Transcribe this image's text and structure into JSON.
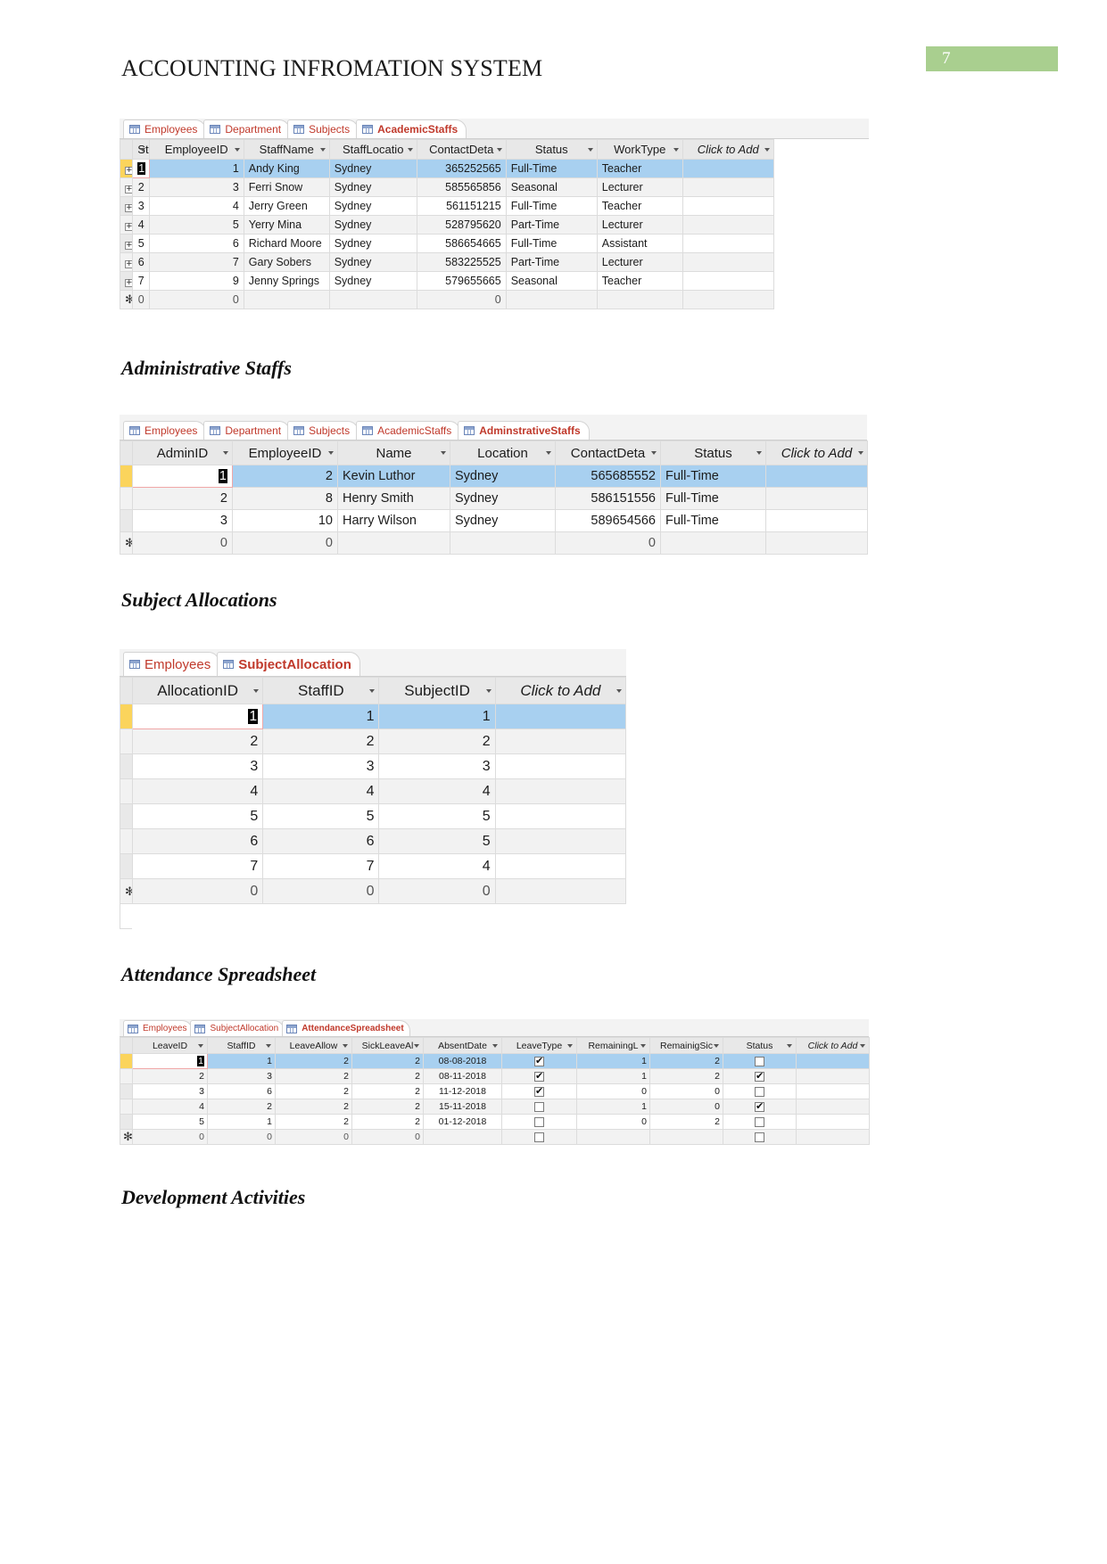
{
  "document": {
    "title": "ACCOUNTING INFROMATION SYSTEM",
    "page_number": "7",
    "accent_green": "#a9cf8f",
    "tab_text_color": "#c0392b",
    "pk_header_color": "#fbd45c",
    "selection_color": "#a8d0f0"
  },
  "headings": {
    "administrative": "Administrative Staffs",
    "subject_allocations": "Subject Allocations",
    "attendance": "Attendance Spreadsheet",
    "development": "Development Activities"
  },
  "academic_staffs": {
    "tabs": [
      {
        "label": "Employees",
        "active": false
      },
      {
        "label": "Department",
        "active": false
      },
      {
        "label": "Subjects",
        "active": false
      },
      {
        "label": "AcademicStaffs",
        "active": true
      }
    ],
    "columns": [
      "StaffID",
      "EmployeeID",
      "StaffName",
      "StaffLocatio",
      "ContactDeta",
      "Status",
      "WorkType",
      "Click to Add"
    ],
    "rows": [
      {
        "StaffID": "1",
        "EmployeeID": "1",
        "StaffName": "Andy King",
        "StaffLocatio": "Sydney",
        "ContactDeta": "365252565",
        "Status": "Full-Time",
        "WorkType": "Teacher"
      },
      {
        "StaffID": "2",
        "EmployeeID": "3",
        "StaffName": "Ferri Snow",
        "StaffLocatio": "Sydney",
        "ContactDeta": "585565856",
        "Status": "Seasonal",
        "WorkType": "Lecturer"
      },
      {
        "StaffID": "3",
        "EmployeeID": "4",
        "StaffName": "Jerry Green",
        "StaffLocatio": "Sydney",
        "ContactDeta": "561151215",
        "Status": "Full-Time",
        "WorkType": "Teacher"
      },
      {
        "StaffID": "4",
        "EmployeeID": "5",
        "StaffName": "Yerry Mina",
        "StaffLocatio": "Sydney",
        "ContactDeta": "528795620",
        "Status": "Part-Time",
        "WorkType": "Lecturer"
      },
      {
        "StaffID": "5",
        "EmployeeID": "6",
        "StaffName": "Richard Moore",
        "StaffLocatio": "Sydney",
        "ContactDeta": "586654665",
        "Status": "Full-Time",
        "WorkType": "Assistant"
      },
      {
        "StaffID": "6",
        "EmployeeID": "7",
        "StaffName": "Gary Sobers",
        "StaffLocatio": "Sydney",
        "ContactDeta": "583225525",
        "Status": "Part-Time",
        "WorkType": "Lecturer"
      },
      {
        "StaffID": "7",
        "EmployeeID": "9",
        "StaffName": "Jenny Springs",
        "StaffLocatio": "Sydney",
        "ContactDeta": "579655665",
        "Status": "Seasonal",
        "WorkType": "Teacher"
      }
    ],
    "new_row": {
      "StaffID": "0",
      "EmployeeID": "0",
      "StaffName": "",
      "StaffLocatio": "",
      "ContactDeta": "0",
      "Status": "",
      "WorkType": ""
    }
  },
  "administrative_staffs": {
    "tabs": [
      {
        "label": "Employees",
        "active": false
      },
      {
        "label": "Department",
        "active": false
      },
      {
        "label": "Subjects",
        "active": false
      },
      {
        "label": "AcademicStaffs",
        "active": false
      },
      {
        "label": "AdminstrativeStaffs",
        "active": true
      }
    ],
    "columns": [
      "AdminID",
      "EmployeeID",
      "Name",
      "Location",
      "ContactDeta",
      "Status",
      "Click to Add"
    ],
    "rows": [
      {
        "AdminID": "1",
        "EmployeeID": "2",
        "Name": "Kevin Luthor",
        "Location": "Sydney",
        "ContactDeta": "565685552",
        "Status": "Full-Time"
      },
      {
        "AdminID": "2",
        "EmployeeID": "8",
        "Name": "Henry Smith",
        "Location": "Sydney",
        "ContactDeta": "586151556",
        "Status": "Full-Time"
      },
      {
        "AdminID": "3",
        "EmployeeID": "10",
        "Name": "Harry Wilson",
        "Location": "Sydney",
        "ContactDeta": "589654566",
        "Status": "Full-Time"
      }
    ],
    "new_row": {
      "AdminID": "0",
      "EmployeeID": "0",
      "Name": "",
      "Location": "",
      "ContactDeta": "0",
      "Status": ""
    }
  },
  "subject_allocation": {
    "tabs": [
      {
        "label": "Employees",
        "active": false
      },
      {
        "label": "SubjectAllocation",
        "active": true
      }
    ],
    "columns": [
      "AllocationID",
      "StaffID",
      "SubjectID",
      "Click to Add"
    ],
    "rows": [
      {
        "AllocationID": "1",
        "StaffID": "1",
        "SubjectID": "1"
      },
      {
        "AllocationID": "2",
        "StaffID": "2",
        "SubjectID": "2"
      },
      {
        "AllocationID": "3",
        "StaffID": "3",
        "SubjectID": "3"
      },
      {
        "AllocationID": "4",
        "StaffID": "4",
        "SubjectID": "4"
      },
      {
        "AllocationID": "5",
        "StaffID": "5",
        "SubjectID": "5"
      },
      {
        "AllocationID": "6",
        "StaffID": "6",
        "SubjectID": "5"
      },
      {
        "AllocationID": "7",
        "StaffID": "7",
        "SubjectID": "4"
      }
    ],
    "new_row": {
      "AllocationID": "0",
      "StaffID": "0",
      "SubjectID": "0"
    }
  },
  "attendance_spreadsheet": {
    "tabs": [
      {
        "label": "Employees",
        "active": false
      },
      {
        "label": "SubjectAllocation",
        "active": false
      },
      {
        "label": "AttendanceSpreadsheet",
        "active": true
      }
    ],
    "columns": [
      "LeaveID",
      "StaffID",
      "LeaveAllow",
      "SickLeaveAl",
      "AbsentDate",
      "LeaveType",
      "RemainingL",
      "RemainigSic",
      "Status",
      "Click to Add"
    ],
    "rows": [
      {
        "LeaveID": "1",
        "StaffID": "1",
        "LeaveAllow": "2",
        "SickLeaveAl": "2",
        "AbsentDate": "08-08-2018",
        "LeaveType": true,
        "RemainingL": "1",
        "RemainigSic": "2",
        "Status": false
      },
      {
        "LeaveID": "2",
        "StaffID": "3",
        "LeaveAllow": "2",
        "SickLeaveAl": "2",
        "AbsentDate": "08-11-2018",
        "LeaveType": true,
        "RemainingL": "1",
        "RemainigSic": "2",
        "Status": true
      },
      {
        "LeaveID": "3",
        "StaffID": "6",
        "LeaveAllow": "2",
        "SickLeaveAl": "2",
        "AbsentDate": "11-12-2018",
        "LeaveType": true,
        "RemainingL": "0",
        "RemainigSic": "0",
        "Status": false
      },
      {
        "LeaveID": "4",
        "StaffID": "2",
        "LeaveAllow": "2",
        "SickLeaveAl": "2",
        "AbsentDate": "15-11-2018",
        "LeaveType": false,
        "RemainingL": "1",
        "RemainigSic": "0",
        "Status": true
      },
      {
        "LeaveID": "5",
        "StaffID": "1",
        "LeaveAllow": "2",
        "SickLeaveAl": "2",
        "AbsentDate": "01-12-2018",
        "LeaveType": false,
        "RemainingL": "0",
        "RemainigSic": "2",
        "Status": false
      }
    ],
    "new_row": {
      "LeaveID": "0",
      "StaffID": "0",
      "LeaveAllow": "0",
      "SickLeaveAl": "0",
      "AbsentDate": "",
      "LeaveType": false,
      "RemainingL": "",
      "RemainigSic": "",
      "Status": false
    }
  }
}
